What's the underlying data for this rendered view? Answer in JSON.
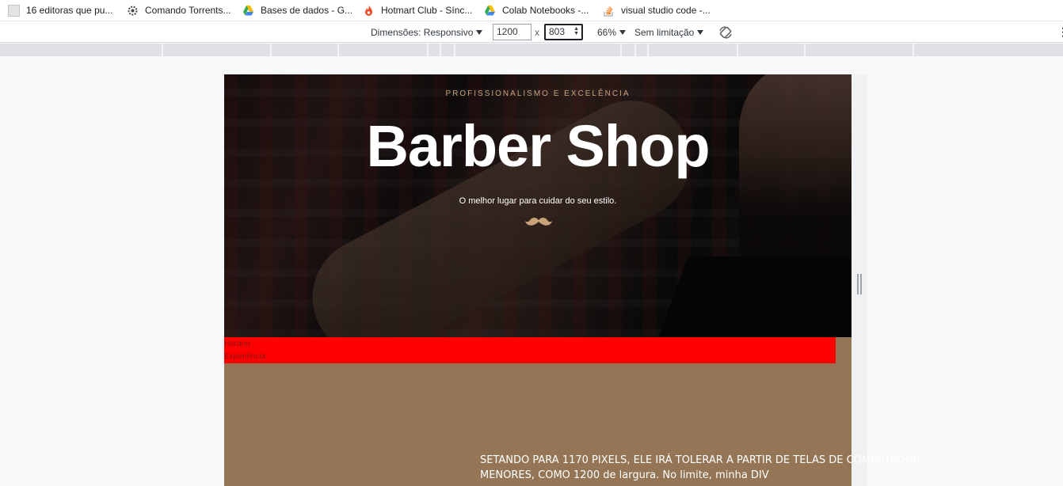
{
  "bookmarks": [
    {
      "label": "16 editoras que pu...",
      "icon": "page-icon"
    },
    {
      "label": "Comando Torrents...",
      "icon": "gear-icon"
    },
    {
      "label": "Bases de dados - G...",
      "icon": "drive-icon"
    },
    {
      "label": "Hotmart Club - Sínc...",
      "icon": "flame-icon"
    },
    {
      "label": "Colab Notebooks -...",
      "icon": "drive-icon"
    },
    {
      "label": "visual studio code -...",
      "icon": "stack-icon"
    }
  ],
  "devtools": {
    "dimensions_label": "Dimensões: Responsivo",
    "width_value": "1200",
    "times": "x",
    "height_value": "803",
    "zoom": "66%",
    "throttle": "Sem limitação",
    "more": "⋮"
  },
  "hero": {
    "tagline": "PROFISSIONALISMO E EXCELÊNCIA",
    "title": "Barber Shop",
    "subtitle": "O melhor lugar para cuidar do seu estilo."
  },
  "nav": {
    "items": [
      "Horário",
      "Experiência"
    ]
  },
  "note": {
    "line1": "SETANDO PARA 1170 PIXELS, ELE IRÁ TOLERAR  A PARTIR DE TELAS DE COMPUTADOR",
    "line2": "MENORES, COMO 1200 de largura.  No limite, minha DIV"
  },
  "colors": {
    "accent_gold": "#c9a27a",
    "nav_red": "#ff0000",
    "section_tan": "#947656"
  }
}
